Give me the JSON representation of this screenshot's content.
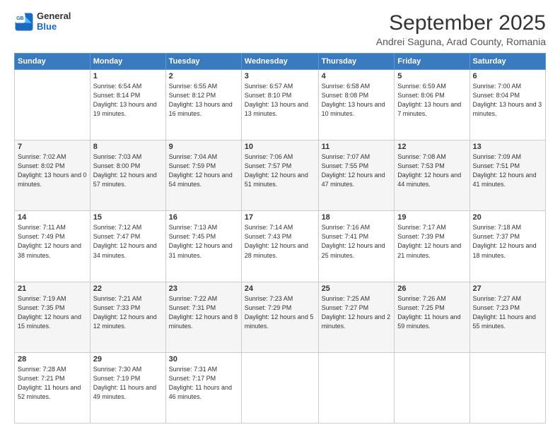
{
  "logo": {
    "line1": "General",
    "line2": "Blue"
  },
  "title": "September 2025",
  "subtitle": "Andrei Saguna, Arad County, Romania",
  "days_header": [
    "Sunday",
    "Monday",
    "Tuesday",
    "Wednesday",
    "Thursday",
    "Friday",
    "Saturday"
  ],
  "weeks": [
    [
      {
        "day": "",
        "sunrise": "",
        "sunset": "",
        "daylight": ""
      },
      {
        "day": "1",
        "sunrise": "6:54 AM",
        "sunset": "8:14 PM",
        "daylight": "13 hours and 19 minutes."
      },
      {
        "day": "2",
        "sunrise": "6:55 AM",
        "sunset": "8:12 PM",
        "daylight": "13 hours and 16 minutes."
      },
      {
        "day": "3",
        "sunrise": "6:57 AM",
        "sunset": "8:10 PM",
        "daylight": "13 hours and 13 minutes."
      },
      {
        "day": "4",
        "sunrise": "6:58 AM",
        "sunset": "8:08 PM",
        "daylight": "13 hours and 10 minutes."
      },
      {
        "day": "5",
        "sunrise": "6:59 AM",
        "sunset": "8:06 PM",
        "daylight": "13 hours and 7 minutes."
      },
      {
        "day": "6",
        "sunrise": "7:00 AM",
        "sunset": "8:04 PM",
        "daylight": "13 hours and 3 minutes."
      }
    ],
    [
      {
        "day": "7",
        "sunrise": "7:02 AM",
        "sunset": "8:02 PM",
        "daylight": "13 hours and 0 minutes."
      },
      {
        "day": "8",
        "sunrise": "7:03 AM",
        "sunset": "8:00 PM",
        "daylight": "12 hours and 57 minutes."
      },
      {
        "day": "9",
        "sunrise": "7:04 AM",
        "sunset": "7:59 PM",
        "daylight": "12 hours and 54 minutes."
      },
      {
        "day": "10",
        "sunrise": "7:06 AM",
        "sunset": "7:57 PM",
        "daylight": "12 hours and 51 minutes."
      },
      {
        "day": "11",
        "sunrise": "7:07 AM",
        "sunset": "7:55 PM",
        "daylight": "12 hours and 47 minutes."
      },
      {
        "day": "12",
        "sunrise": "7:08 AM",
        "sunset": "7:53 PM",
        "daylight": "12 hours and 44 minutes."
      },
      {
        "day": "13",
        "sunrise": "7:09 AM",
        "sunset": "7:51 PM",
        "daylight": "12 hours and 41 minutes."
      }
    ],
    [
      {
        "day": "14",
        "sunrise": "7:11 AM",
        "sunset": "7:49 PM",
        "daylight": "12 hours and 38 minutes."
      },
      {
        "day": "15",
        "sunrise": "7:12 AM",
        "sunset": "7:47 PM",
        "daylight": "12 hours and 34 minutes."
      },
      {
        "day": "16",
        "sunrise": "7:13 AM",
        "sunset": "7:45 PM",
        "daylight": "12 hours and 31 minutes."
      },
      {
        "day": "17",
        "sunrise": "7:14 AM",
        "sunset": "7:43 PM",
        "daylight": "12 hours and 28 minutes."
      },
      {
        "day": "18",
        "sunrise": "7:16 AM",
        "sunset": "7:41 PM",
        "daylight": "12 hours and 25 minutes."
      },
      {
        "day": "19",
        "sunrise": "7:17 AM",
        "sunset": "7:39 PM",
        "daylight": "12 hours and 21 minutes."
      },
      {
        "day": "20",
        "sunrise": "7:18 AM",
        "sunset": "7:37 PM",
        "daylight": "12 hours and 18 minutes."
      }
    ],
    [
      {
        "day": "21",
        "sunrise": "7:19 AM",
        "sunset": "7:35 PM",
        "daylight": "12 hours and 15 minutes."
      },
      {
        "day": "22",
        "sunrise": "7:21 AM",
        "sunset": "7:33 PM",
        "daylight": "12 hours and 12 minutes."
      },
      {
        "day": "23",
        "sunrise": "7:22 AM",
        "sunset": "7:31 PM",
        "daylight": "12 hours and 8 minutes."
      },
      {
        "day": "24",
        "sunrise": "7:23 AM",
        "sunset": "7:29 PM",
        "daylight": "12 hours and 5 minutes."
      },
      {
        "day": "25",
        "sunrise": "7:25 AM",
        "sunset": "7:27 PM",
        "daylight": "12 hours and 2 minutes."
      },
      {
        "day": "26",
        "sunrise": "7:26 AM",
        "sunset": "7:25 PM",
        "daylight": "11 hours and 59 minutes."
      },
      {
        "day": "27",
        "sunrise": "7:27 AM",
        "sunset": "7:23 PM",
        "daylight": "11 hours and 55 minutes."
      }
    ],
    [
      {
        "day": "28",
        "sunrise": "7:28 AM",
        "sunset": "7:21 PM",
        "daylight": "11 hours and 52 minutes."
      },
      {
        "day": "29",
        "sunrise": "7:30 AM",
        "sunset": "7:19 PM",
        "daylight": "11 hours and 49 minutes."
      },
      {
        "day": "30",
        "sunrise": "7:31 AM",
        "sunset": "7:17 PM",
        "daylight": "11 hours and 46 minutes."
      },
      {
        "day": "",
        "sunrise": "",
        "sunset": "",
        "daylight": ""
      },
      {
        "day": "",
        "sunrise": "",
        "sunset": "",
        "daylight": ""
      },
      {
        "day": "",
        "sunrise": "",
        "sunset": "",
        "daylight": ""
      },
      {
        "day": "",
        "sunrise": "",
        "sunset": "",
        "daylight": ""
      }
    ]
  ],
  "labels": {
    "sunrise_prefix": "Sunrise: ",
    "sunset_prefix": "Sunset: ",
    "daylight_prefix": "Daylight: "
  }
}
